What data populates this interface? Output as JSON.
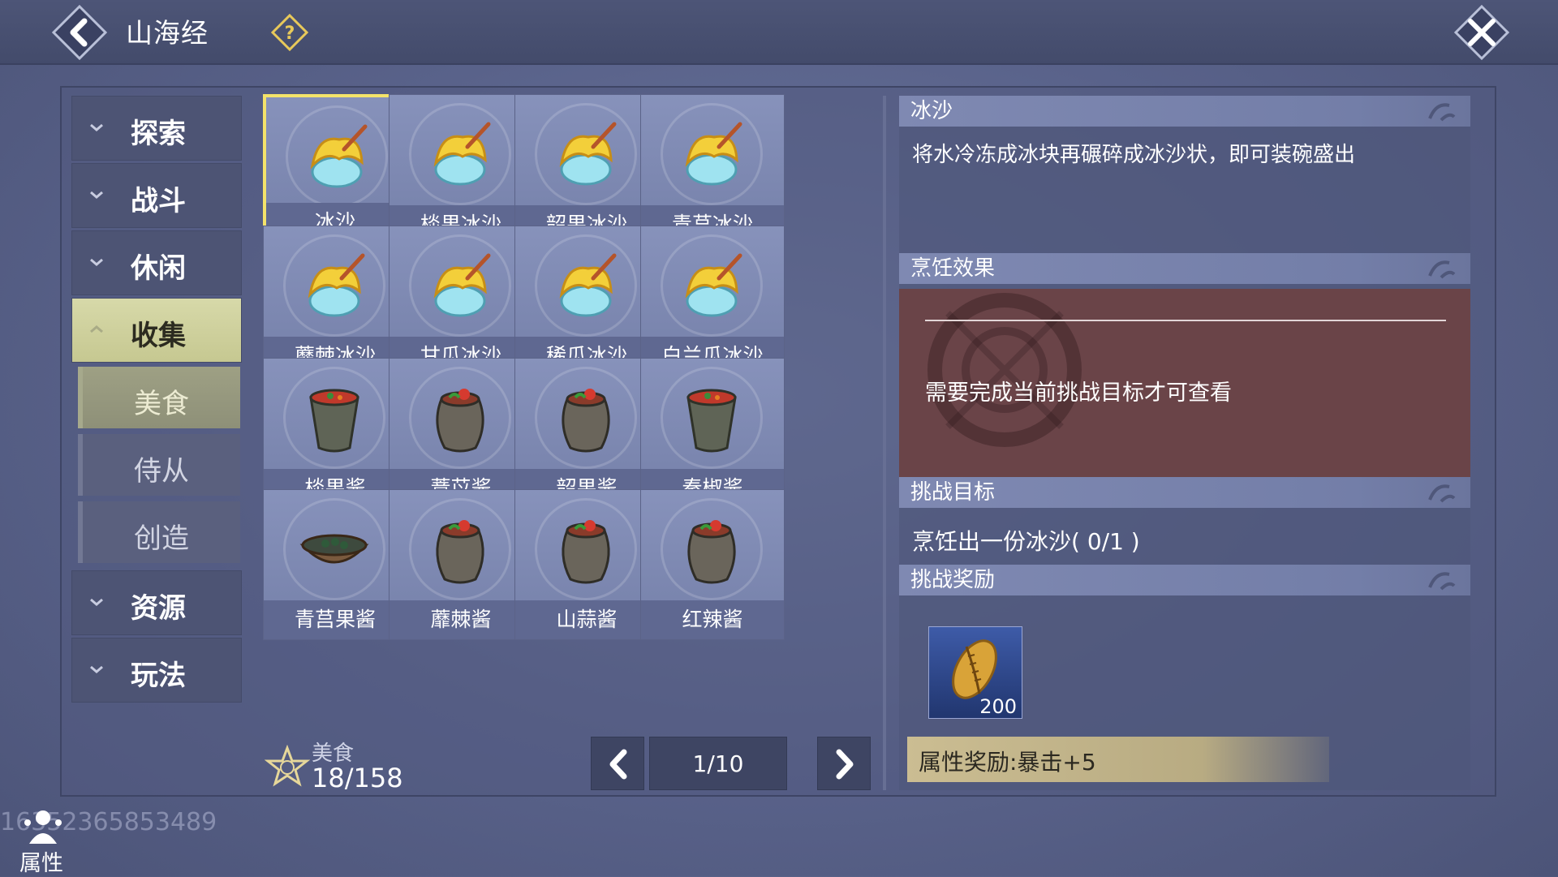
{
  "header": {
    "title": "山海经"
  },
  "sidebar": {
    "categories": [
      {
        "label": "探索"
      },
      {
        "label": "战斗"
      },
      {
        "label": "休闲"
      },
      {
        "label": "收集"
      },
      {
        "label": "资源"
      },
      {
        "label": "玩法"
      }
    ],
    "subitems": [
      {
        "label": "美食"
      },
      {
        "label": "侍从"
      },
      {
        "label": "创造"
      }
    ],
    "active_category": "收集",
    "active_subitem": "美食"
  },
  "grid": {
    "items": [
      {
        "name": "冰沙",
        "icon": "shaved-ice-icon",
        "selected": true
      },
      {
        "name": "棪果冰沙",
        "icon": "shaved-ice-icon"
      },
      {
        "name": "韶果冰沙",
        "icon": "shaved-ice-icon"
      },
      {
        "name": "青莒冰沙",
        "icon": "shaved-ice-icon"
      },
      {
        "name": "蘼棘冰沙",
        "icon": "shaved-ice-icon"
      },
      {
        "name": "甘瓜冰沙",
        "icon": "shaved-ice-icon"
      },
      {
        "name": "稀瓜冰沙",
        "icon": "shaved-ice-icon"
      },
      {
        "name": "白兰瓜冰沙",
        "icon": "shaved-ice-icon"
      },
      {
        "name": "棪果酱",
        "icon": "sauce-cup-icon"
      },
      {
        "name": "薏苡酱",
        "icon": "sauce-jar-icon"
      },
      {
        "name": "韶果酱",
        "icon": "sauce-jar-icon"
      },
      {
        "name": "秦椒酱",
        "icon": "sauce-cup-icon"
      },
      {
        "name": "青莒果酱",
        "icon": "sauce-bowl-icon"
      },
      {
        "name": "蘼棘酱",
        "icon": "sauce-jar-icon"
      },
      {
        "name": "山蒜酱",
        "icon": "sauce-jar-icon"
      },
      {
        "name": "红辣酱",
        "icon": "sauce-jar-icon"
      }
    ]
  },
  "collection": {
    "label": "美食",
    "count": "18/158"
  },
  "pager": {
    "text": "1/10"
  },
  "detail": {
    "name": "冰沙",
    "description": "将水冷冻成冰块再碾碎成冰沙状，即可装碗盛出",
    "effect_header": "烹饪效果",
    "effect_locked_text": "需要完成当前挑战目标才可查看",
    "target_header": "挑战目标",
    "target_text": "烹饪出一份冰沙( 0/1 )",
    "reward_header": "挑战奖励",
    "reward_quantity": "200",
    "attribute_reward": "属性奖励:暴击+5"
  },
  "footer": {
    "uid": "16352365853489",
    "attribute_label": "属性"
  },
  "colors": {
    "accent_yellow": "#f4e36a",
    "locked_panel": "#6a4448",
    "active_tab": "#d7d9a9"
  }
}
